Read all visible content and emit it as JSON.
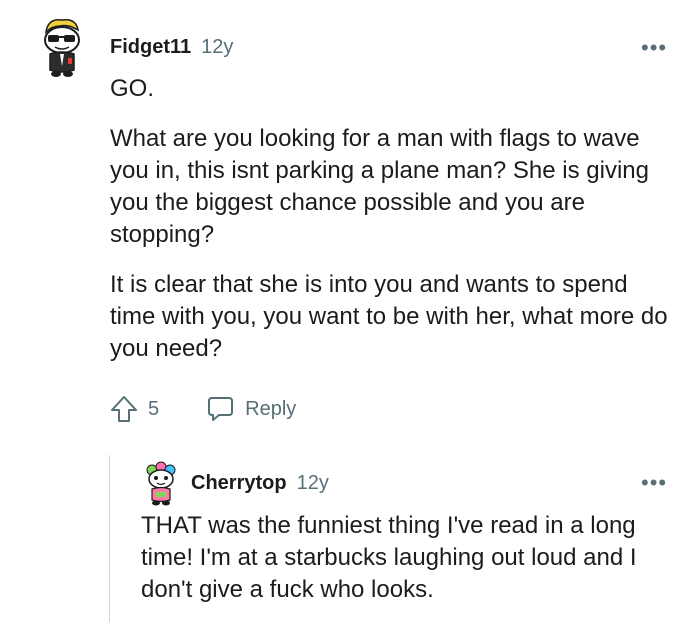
{
  "comments": [
    {
      "username": "Fidget11",
      "age": "12y",
      "more_label": "•••",
      "paragraphs": [
        "GO.",
        "What are you looking for a man with flags to wave you in, this isnt parking a plane man? She is giving you the biggest chance possible and you are stopping?",
        "It is clear that she is into you and wants to spend time with you, you want to be with her, what more do you need?"
      ],
      "score": "5",
      "reply_label": "Reply",
      "avatar_icon": "snoo-sunglasses-avatar-icon"
    },
    {
      "username": "Cherrytop",
      "age": "12y",
      "more_label": "•••",
      "paragraphs": [
        "THAT was the funniest thing I've read in a long time! I'm at a starbucks laughing out loud and I don't give a fuck who looks."
      ],
      "avatar_icon": "snoo-colorful-hair-avatar-icon"
    }
  ],
  "colors": {
    "text": "#1c1c1c",
    "meta": "#576f76",
    "thread_line": "#d4d7d9"
  }
}
